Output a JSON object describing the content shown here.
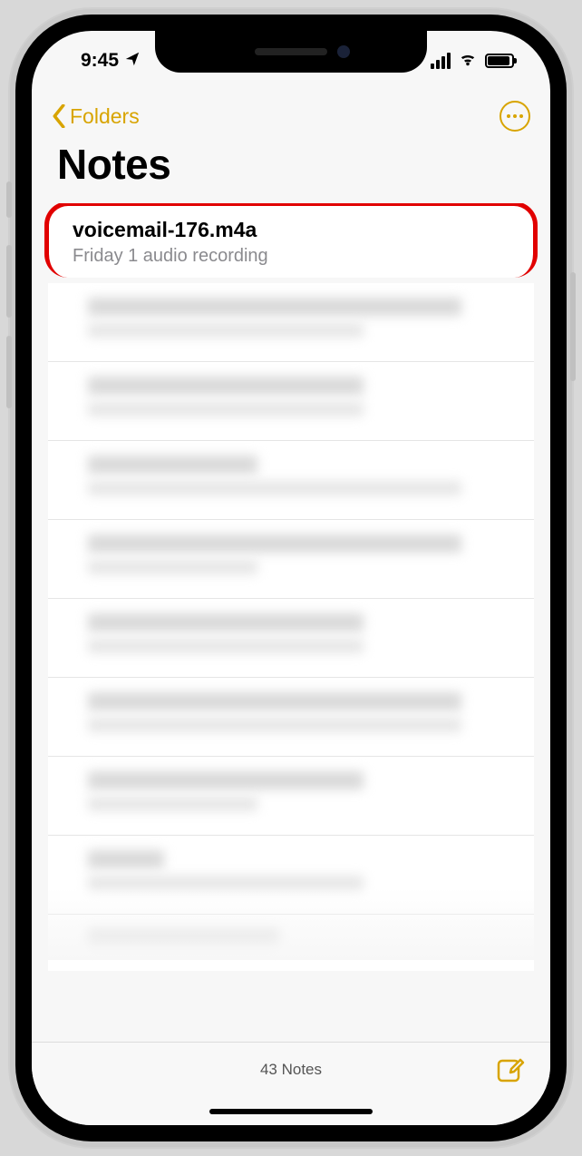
{
  "status": {
    "time": "9:45",
    "location_services": true
  },
  "nav": {
    "back_label": "Folders"
  },
  "page_title": "Notes",
  "notes": [
    {
      "title": "voicemail-176.m4a",
      "subtitle": "Friday  1 audio recording",
      "highlighted": true
    }
  ],
  "toolbar": {
    "count_label": "43 Notes"
  },
  "colors": {
    "accent": "#d8a400",
    "highlight_ring": "#e10000"
  }
}
